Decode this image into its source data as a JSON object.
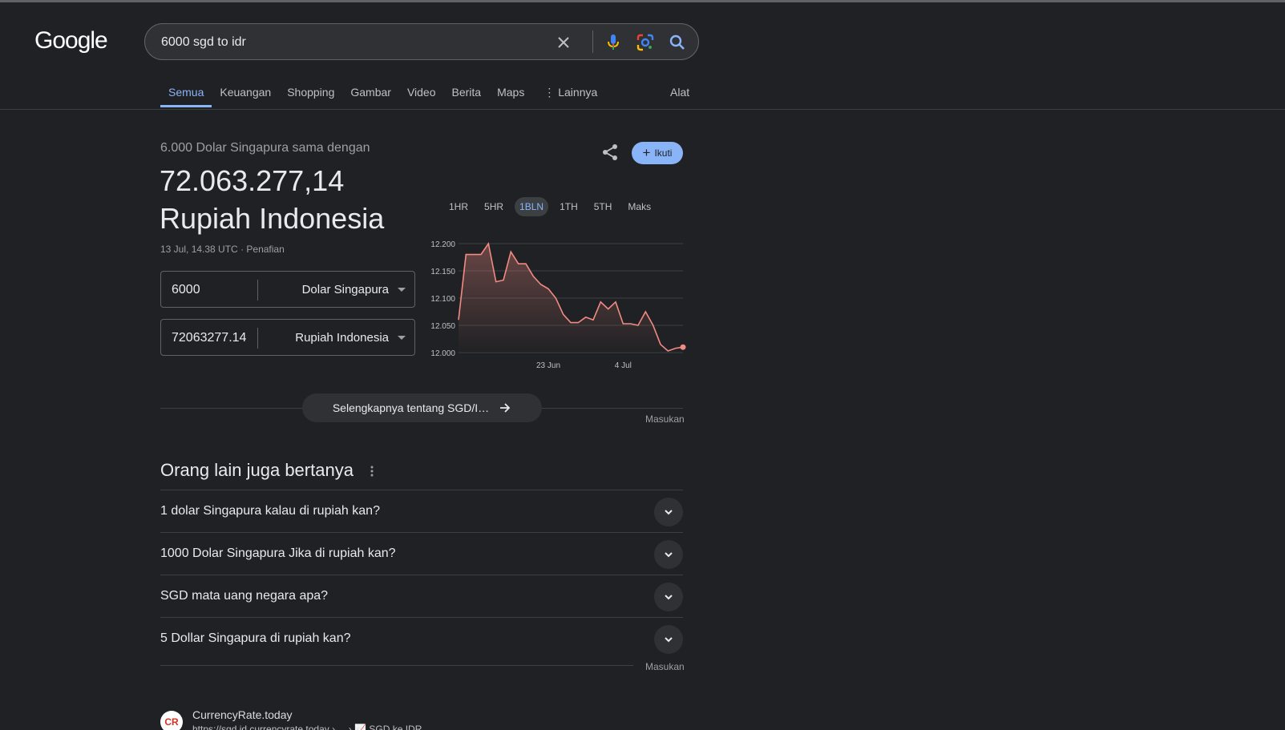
{
  "logo": "Google",
  "search": {
    "query": "6000 sgd to idr"
  },
  "tabs": [
    "Semua",
    "Keuangan",
    "Shopping",
    "Gambar",
    "Video",
    "Berita",
    "Maps",
    "Lainnya"
  ],
  "tools_label": "Alat",
  "converter": {
    "subtitle": "6.000 Dolar Singapura sama dengan",
    "result_value": "72.063.277,14",
    "result_currency": "Rupiah Indonesia",
    "timestamp": "13 Jul, 14.38 UTC",
    "separator": "·",
    "disclaimer": "Penafian",
    "from_amount": "6000",
    "from_currency": "Dolar Singapura",
    "to_amount": "72063277.14",
    "to_currency": "Rupiah Indonesia"
  },
  "follow_label": "Ikuti",
  "ranges": [
    "1HR",
    "5HR",
    "1BLN",
    "1TH",
    "5TH",
    "Maks"
  ],
  "active_range": "1BLN",
  "more_label": "Selengkapnya tentang SGD/I…",
  "feedback_label": "Masukan",
  "paa": {
    "title": "Orang lain juga bertanya",
    "questions": [
      "1 dolar Singapura kalau di rupiah kan?",
      "1000 Dolar Singapura Jika di rupiah kan?",
      "SGD mata uang negara apa?",
      "5 Dollar Singapura di rupiah kan?"
    ]
  },
  "result": {
    "favicon": "CR",
    "site": "CurrencyRate.today",
    "url": "https://sgd.id.currencyrate.today › ... › 📈 SGD ke IDR"
  },
  "colors": {
    "accent": "#8ab4f8",
    "chart_line": "#f28b82",
    "background": "#202124"
  },
  "chart_data": {
    "type": "area",
    "x": [
      0,
      1,
      2,
      3,
      4,
      5,
      6,
      7,
      8,
      9,
      10,
      11,
      12,
      13,
      14,
      15,
      16,
      17,
      18,
      19,
      20,
      21,
      22,
      23,
      24,
      25,
      26,
      27,
      28,
      29,
      30,
      31,
      32,
      33
    ],
    "values": [
      12060,
      12180,
      12180,
      12180,
      12200,
      12130,
      12133,
      12185,
      12163,
      12163,
      12140,
      12125,
      12117,
      12100,
      12070,
      12055,
      12055,
      12065,
      12060,
      12093,
      12080,
      12093,
      12053,
      12053,
      12050,
      12075,
      12050,
      12015,
      12003,
      12008,
      12010
    ],
    "x_tick_labels": [
      {
        "label": "23 Jun",
        "x": 12
      },
      {
        "label": "4 Jul",
        "x": 22
      }
    ],
    "y_tick_labels": [
      "12.200",
      "12.150",
      "12.100",
      "12.050",
      "12.000"
    ],
    "y_ticks": [
      12200,
      12150,
      12100,
      12050,
      12000
    ],
    "ylim": [
      12000,
      12200
    ],
    "grid": true
  }
}
